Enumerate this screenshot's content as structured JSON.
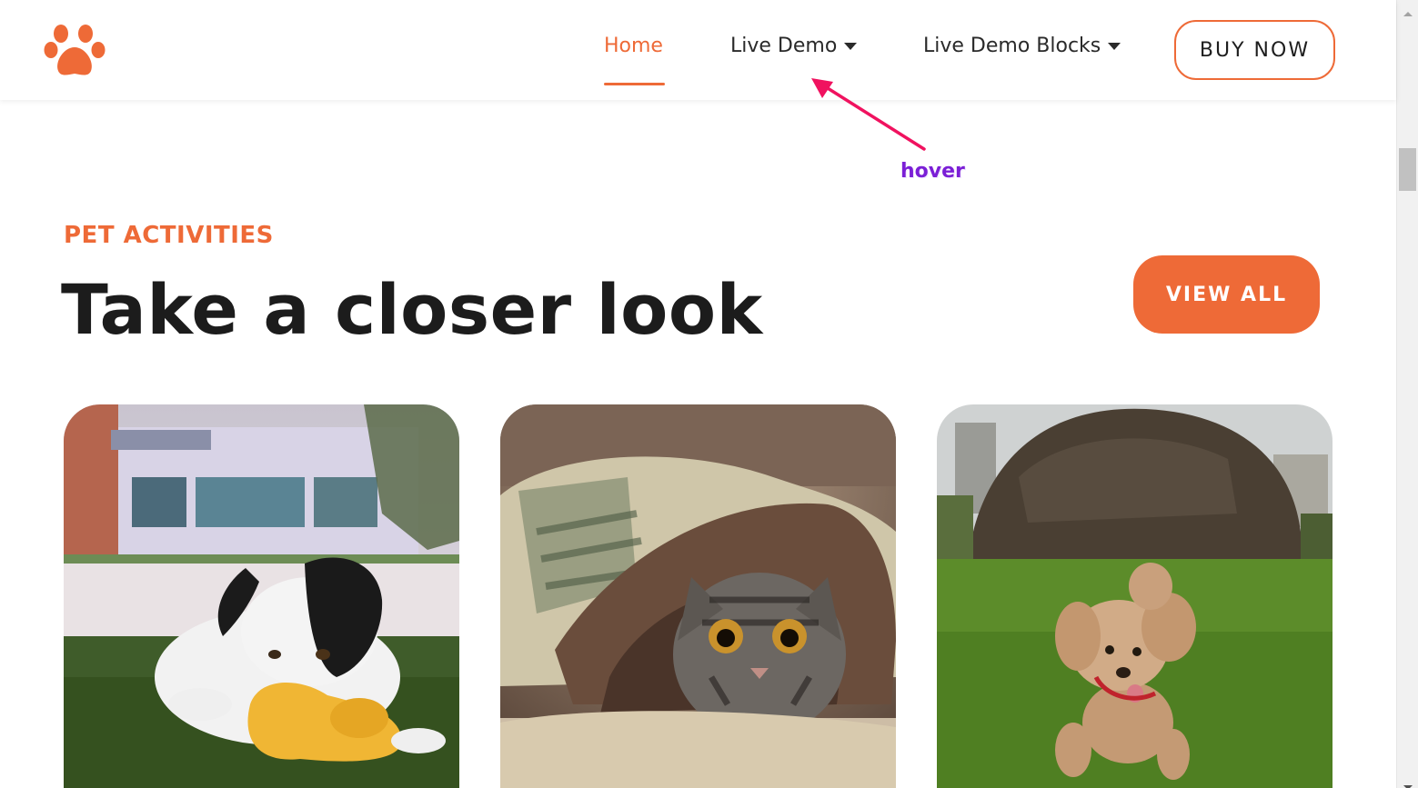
{
  "header": {
    "logo_icon": "paw-icon",
    "nav": {
      "home": "Home",
      "live_demo": "Live Demo",
      "live_demo_blocks": "Live Demo Blocks"
    },
    "buy_now": "BUY NOW"
  },
  "annotation": {
    "label": "hover",
    "icon": "arrow-icon"
  },
  "section": {
    "eyebrow": "PET ACTIVITIES",
    "title": "Take a closer look",
    "view_all": "VIEW ALL"
  },
  "cards": [
    {
      "image": "dog-with-toy-image"
    },
    {
      "image": "cat-under-blanket-image"
    },
    {
      "image": "running-puppy-image"
    }
  ],
  "colors": {
    "accent": "#ee6a37",
    "annotation": "#7b1fd6",
    "arrow": "#f0125f"
  }
}
